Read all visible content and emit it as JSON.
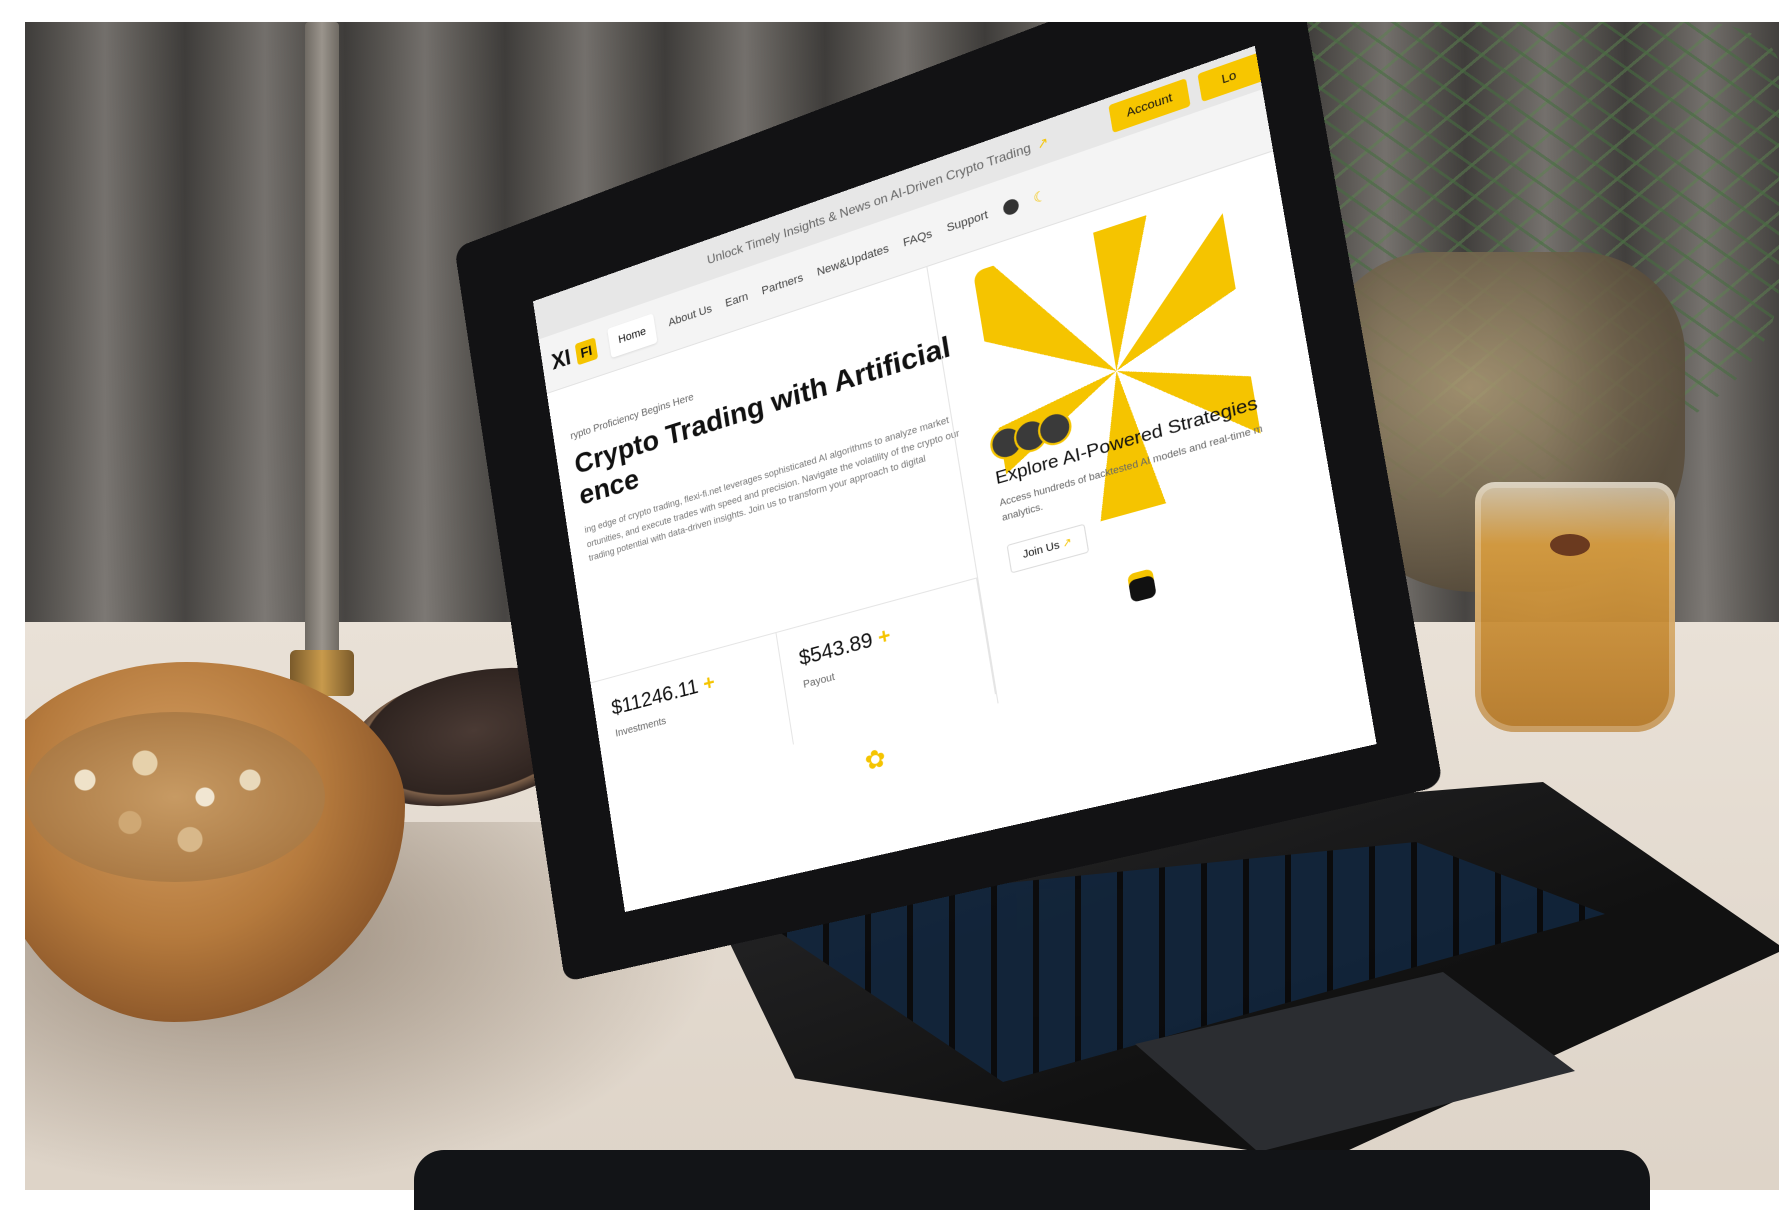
{
  "site": {
    "announcement": "Unlock Timely Insights & News on AI-Driven Crypto Trading",
    "announcement_arrow": "↗",
    "account_label": "Account",
    "login_label": "Lo",
    "logo_text": "XI",
    "logo_mark": "FI",
    "nav": [
      {
        "label": "Home"
      },
      {
        "label": "About Us"
      },
      {
        "label": "Earn"
      },
      {
        "label": "Partners"
      },
      {
        "label": "New&Updates"
      },
      {
        "label": "FAQs"
      },
      {
        "label": "Support"
      }
    ],
    "hero": {
      "kicker": "rypto Proficiency Begins Here",
      "headline_line1": "Crypto Trading with Artificial",
      "headline_line2": "ence",
      "description": "ing edge of crypto trading, flexi-fi.net leverages sophisticated AI algorithms to analyze market ortunities, and execute trades with speed and precision. Navigate the volatility of the crypto our trading potential with data-driven insights. Join us to transform your approach to digital"
    },
    "stats": [
      {
        "value": "$11246.11",
        "plus": "+",
        "label": "Investments"
      },
      {
        "value": "$543.89",
        "plus": "+",
        "label": "Payout"
      }
    ],
    "promo": {
      "title": "Explore AI-Powered Strategies",
      "description": "Access hundreds of backtested AI models and real-time m analytics.",
      "join_label": "Join Us",
      "join_arrow": "↗"
    }
  },
  "colors": {
    "accent": "#f5c400",
    "dark": "#121214"
  }
}
